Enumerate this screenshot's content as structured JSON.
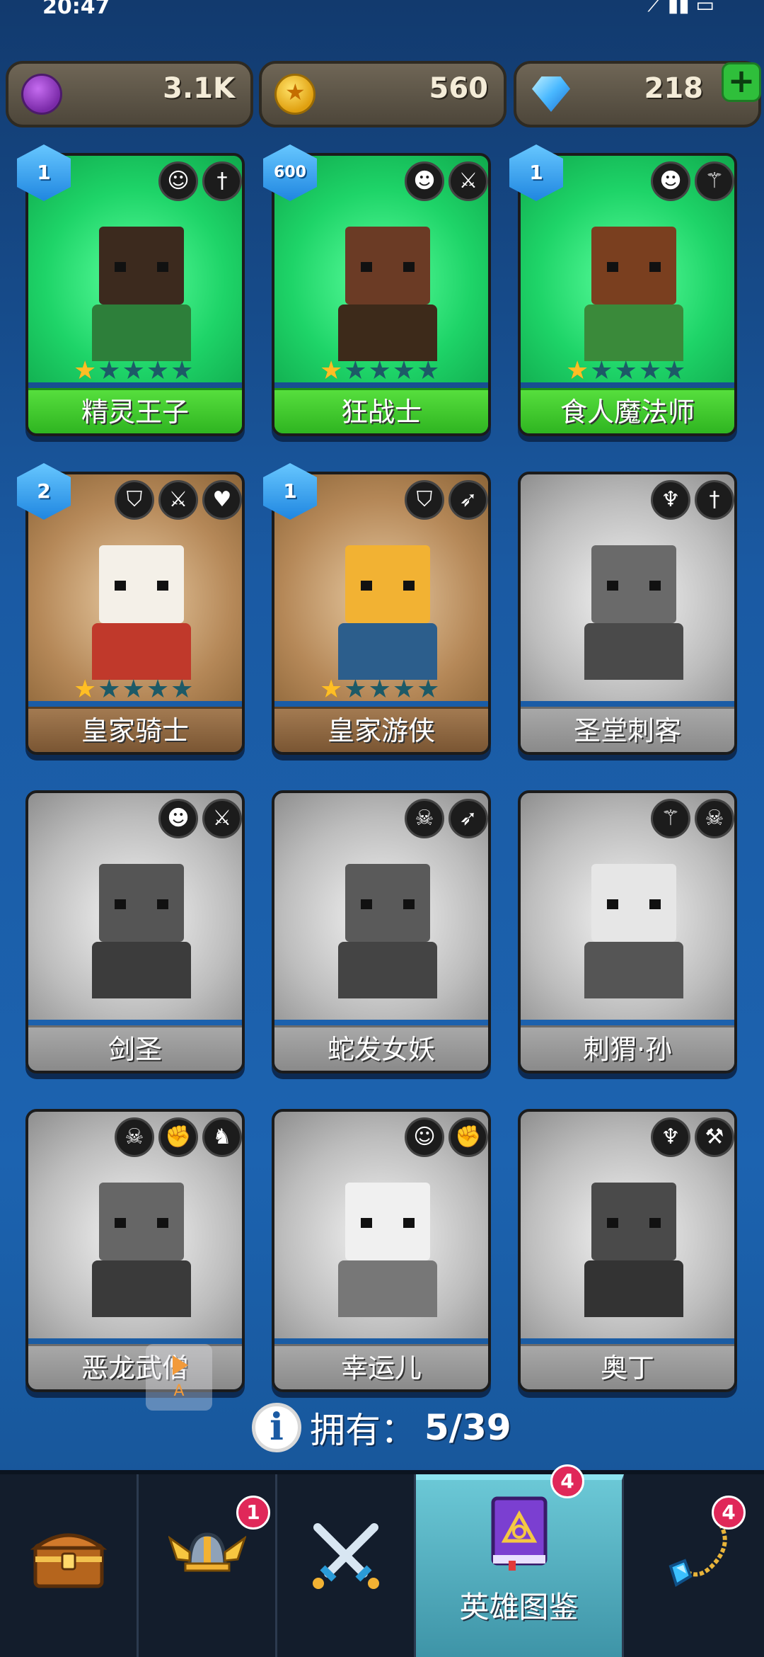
{
  "status_bar": {
    "time": "20:47",
    "icons": "⟋ ▮▮ ▭"
  },
  "currencies": [
    {
      "value": "3.1K",
      "icon": "purple-token-icon"
    },
    {
      "value": "560",
      "icon": "gold-coin-icon"
    },
    {
      "value": "218",
      "icon": "gem-icon",
      "plus": "+"
    }
  ],
  "heroes": [
    {
      "name": "精灵王子",
      "level": "1",
      "stars": 1,
      "rarity": "green",
      "traits": [
        "elf-face-icon",
        "dagger-icon"
      ]
    },
    {
      "name": "狂战士",
      "level": "600",
      "stars": 1,
      "rarity": "green",
      "traits": [
        "orc-face-icon",
        "sword-icon"
      ]
    },
    {
      "name": "食人魔法师",
      "level": "1",
      "stars": 1,
      "rarity": "green",
      "traits": [
        "orc-face-icon",
        "staff-icon"
      ]
    },
    {
      "name": "皇家骑士",
      "level": "2",
      "stars": 1,
      "rarity": "brown",
      "traits": [
        "helmet-icon",
        "sword-icon",
        "heart-icon"
      ]
    },
    {
      "name": "皇家游侠",
      "level": "1",
      "stars": 1,
      "rarity": "brown",
      "traits": [
        "helmet-icon",
        "bow-icon"
      ]
    },
    {
      "name": "圣堂刺客",
      "level": "",
      "stars": 0,
      "rarity": "gray",
      "traits": [
        "wings-icon",
        "dagger-icon"
      ]
    },
    {
      "name": "剑圣",
      "level": "",
      "stars": 0,
      "rarity": "gray",
      "traits": [
        "orc-face-icon",
        "sword-icon"
      ]
    },
    {
      "name": "蛇发女妖",
      "level": "",
      "stars": 0,
      "rarity": "gray",
      "traits": [
        "demon-skull-icon",
        "bow-icon"
      ]
    },
    {
      "name": "刺猬·孙",
      "level": "",
      "stars": 0,
      "rarity": "gray",
      "traits": [
        "staff-icon",
        "demon-skull-icon"
      ]
    },
    {
      "name": "恶龙武僧",
      "level": "",
      "stars": 0,
      "rarity": "gray",
      "traits": [
        "demon-skull-icon",
        "fist-icon",
        "dragon-icon"
      ]
    },
    {
      "name": "幸运儿",
      "level": "",
      "stars": 0,
      "rarity": "gray",
      "traits": [
        "elf-face-icon",
        "fist-icon"
      ]
    },
    {
      "name": "奥丁",
      "level": "",
      "stars": 0,
      "rarity": "gray",
      "traits": [
        "wings-icon",
        "hammer-icon"
      ]
    }
  ],
  "owned": {
    "label": "拥有：",
    "value": "5/39"
  },
  "mini_overlay": {
    "label": "A"
  },
  "nav": {
    "items": [
      {
        "id": "chest",
        "icon": "treasure-chest-icon",
        "label": "",
        "badge": ""
      },
      {
        "id": "heroes",
        "icon": "winged-helmet-icon",
        "label": "",
        "badge": "1"
      },
      {
        "id": "battle",
        "icon": "crossed-swords-icon",
        "label": "",
        "badge": ""
      },
      {
        "id": "codex",
        "icon": "spellbook-icon",
        "label": "英雄图鉴",
        "badge": "4"
      },
      {
        "id": "items",
        "icon": "amulet-icon",
        "label": "",
        "badge": "4"
      }
    ]
  },
  "colors": {
    "bg_top": "#123a6e",
    "bg_mid": "#1c63b0",
    "green_card": "#1ed468",
    "brown_card": "#b58858",
    "gray_card": "#bdbdbd",
    "badge_red": "#e02859"
  }
}
